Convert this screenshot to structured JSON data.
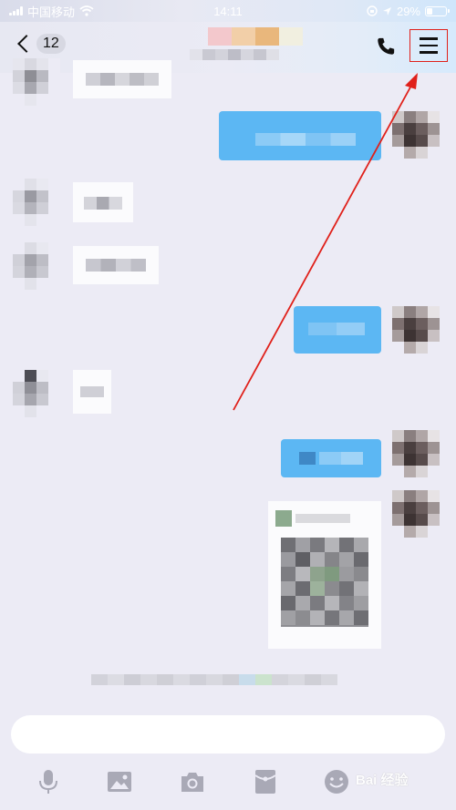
{
  "status_bar": {
    "carrier": "中国移动",
    "time": "14:11",
    "battery": "29%",
    "battery_level": 0.29,
    "wifi_icon": "wifi-icon",
    "location_icon": "location-arrow-icon",
    "lock_icon": "orientation-lock-icon"
  },
  "header": {
    "back_icon": "chevron-left-icon",
    "unread_count": "12",
    "call_icon": "phone-icon",
    "menu_icon": "hamburger-menu-icon",
    "highlight_color": "#e0201a"
  },
  "annotation": {
    "arrow_color": "#e0201a"
  },
  "colors": {
    "background": "#ecebf5",
    "outgoing_bubble": "#5cb7f3",
    "incoming_bubble": "#fbfbfd"
  },
  "input": {
    "value": "",
    "placeholder": ""
  },
  "toolbar": {
    "items": [
      "microphone-icon",
      "image-icon",
      "camera-icon",
      "red-packet-icon",
      "emoji-icon"
    ]
  },
  "watermark": {
    "text": "Bai 经验"
  }
}
